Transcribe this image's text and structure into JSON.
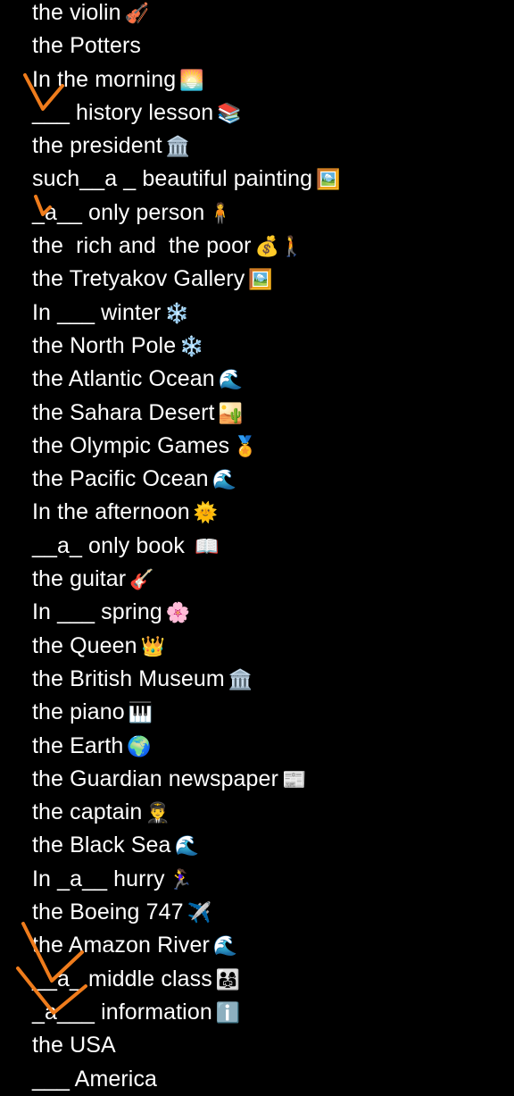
{
  "lines": [
    {
      "text": "the violin",
      "emoji": "🎻"
    },
    {
      "text": "the Potters",
      "emoji": ""
    },
    {
      "text": "In the morning",
      "emoji": "🌅"
    },
    {
      "text": "___ history lesson",
      "emoji": "📚"
    },
    {
      "text": "the president",
      "emoji": "🏛️"
    },
    {
      "text": "such__a _ beautiful painting",
      "emoji": "🖼️"
    },
    {
      "text": "_a__ only person",
      "emoji": "🧍"
    },
    {
      "text": "the  rich and  the poor",
      "emoji": "💰🚶"
    },
    {
      "text": "the Tretyakov Gallery",
      "emoji": "🖼️"
    },
    {
      "text": "In ___ winter",
      "emoji": "❄️"
    },
    {
      "text": "the North Pole",
      "emoji": "❄️"
    },
    {
      "text": "the Atlantic Ocean",
      "emoji": "🌊"
    },
    {
      "text": "the Sahara Desert",
      "emoji": "🏜️"
    },
    {
      "text": "the Olympic Games",
      "emoji": "🏅"
    },
    {
      "text": "the Pacific Ocean",
      "emoji": "🌊"
    },
    {
      "text": "In the afternoon",
      "emoji": "🌞"
    },
    {
      "text": "__a_ only book",
      "emoji": " 📖"
    },
    {
      "text": "the guitar",
      "emoji": "🎸"
    },
    {
      "text": "In ___ spring",
      "emoji": "🌸"
    },
    {
      "text": "the Queen",
      "emoji": "👑"
    },
    {
      "text": "the British Museum",
      "emoji": "🏛️"
    },
    {
      "text": "the piano",
      "emoji": "🎹"
    },
    {
      "text": "the Earth",
      "emoji": "🌍"
    },
    {
      "text": "the Guardian newspaper",
      "emoji": "📰"
    },
    {
      "text": "the captain",
      "emoji": "👨‍✈️"
    },
    {
      "text": "the Black Sea",
      "emoji": "🌊"
    },
    {
      "text": "In _a__ hurry",
      "emoji": "🏃‍♀️"
    },
    {
      "text": "the Boeing 747",
      "emoji": "✈️"
    },
    {
      "text": "the Amazon River",
      "emoji": "🌊"
    },
    {
      "text": "__a_ middle class",
      "emoji": "👨‍👩‍👧"
    },
    {
      "text": "_a___ information",
      "emoji": "ℹ️"
    },
    {
      "text": "the USA",
      "emoji": ""
    },
    {
      "text": "___ America",
      "emoji": ""
    }
  ],
  "colors": {
    "background": "#000000",
    "text": "#ffffff",
    "check_marks": "#ef7c1c"
  }
}
